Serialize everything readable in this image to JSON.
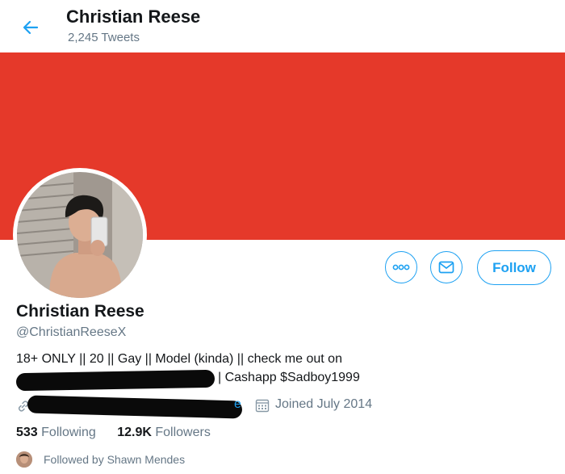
{
  "header": {
    "name": "Christian Reese",
    "tweet_count": "2,245 Tweets",
    "back_icon": "arrow-left-icon"
  },
  "colors": {
    "banner": "#e5392a",
    "accent": "#1da1f2",
    "secondary_text": "#657786",
    "primary_text": "#14171a"
  },
  "actions": {
    "more_icon": "more-horizontal-icon",
    "message_icon": "mail-icon",
    "follow_label": "Follow"
  },
  "profile": {
    "display_name": "Christian Reese",
    "handle": "@ChristianReeseX",
    "bio_line1": "18+ ONLY || 20 || Gay || Model (kinda) || check me out on",
    "bio_line2_tail": "| Cashapp $Sadboy1999",
    "url_tail": "e",
    "joined": "Joined July 2014"
  },
  "stats": {
    "following_count": "533",
    "following_label": "Following",
    "followers_count": "12.9K",
    "followers_label": "Followers"
  },
  "followed_by": "Followed by Shawn Mendes"
}
